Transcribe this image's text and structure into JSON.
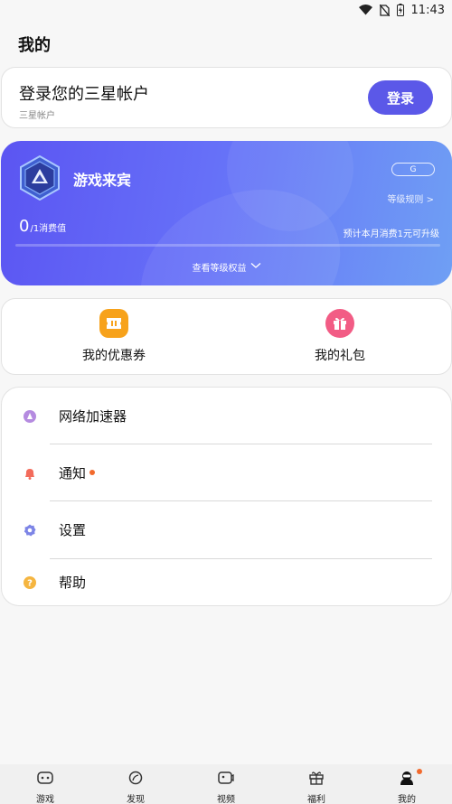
{
  "status_bar": {
    "time": "11:43",
    "icons": [
      "wifi-icon",
      "no-sim-icon",
      "battery-charging-icon"
    ]
  },
  "page_title": "我的",
  "account": {
    "title": "登录您的三星帐户",
    "subtitle": "三星帐户",
    "login_button": "登录"
  },
  "level": {
    "name": "游戏来宾",
    "grade": "G",
    "rules_link": "等级规则 >",
    "points_value": "0",
    "points_unit": "/1消费值",
    "upgrade_hint": "预计本月消费1元可升级",
    "progress": 0,
    "benefits_link": "查看等级权益"
  },
  "shortcuts": [
    {
      "label": "我的优惠券",
      "icon": "ticket-icon",
      "color": "#f7a21b"
    },
    {
      "label": "我的礼包",
      "icon": "gift-icon",
      "color": "#f25c85"
    }
  ],
  "menu": [
    {
      "label": "网络加速器",
      "icon": "accelerator-icon",
      "color": "#b58be0",
      "badge": false
    },
    {
      "label": "通知",
      "icon": "bell-icon",
      "color": "#f36b5b",
      "badge": true
    },
    {
      "label": "设置",
      "icon": "gear-icon",
      "color": "#7d85e6",
      "badge": false
    },
    {
      "label": "帮助",
      "icon": "help-icon",
      "color": "#f5b540",
      "badge": false
    }
  ],
  "bottom_nav": [
    {
      "label": "游戏",
      "icon": "gamepad-icon"
    },
    {
      "label": "发现",
      "icon": "discover-icon"
    },
    {
      "label": "视频",
      "icon": "video-icon"
    },
    {
      "label": "福利",
      "icon": "gift-box-icon"
    },
    {
      "label": "我的",
      "icon": "profile-icon",
      "active": true,
      "badge": true
    }
  ],
  "colors": {
    "accent": "#5b58e8",
    "notification_dot": "#f26a2d"
  }
}
